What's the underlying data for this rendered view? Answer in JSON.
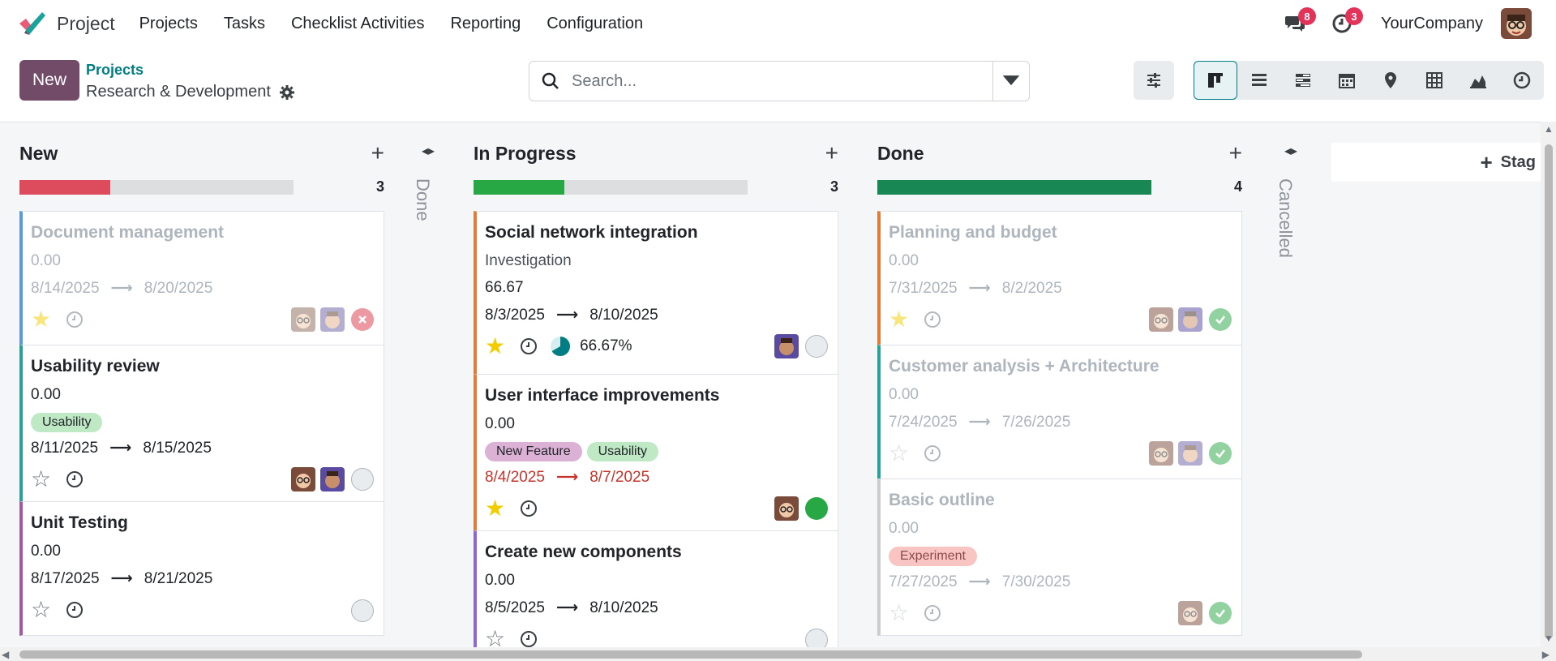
{
  "navbar": {
    "app_name": "Project",
    "menu": [
      "Projects",
      "Tasks",
      "Checklist Activities",
      "Reporting",
      "Configuration"
    ],
    "messages_count": "8",
    "activities_count": "3",
    "company": "YourCompany"
  },
  "control_panel": {
    "new_label": "New",
    "breadcrumb_parent": "Projects",
    "breadcrumb_current": "Research & Development",
    "search_placeholder": "Search..."
  },
  "columns": [
    {
      "title": "New",
      "count": "3",
      "progress_color": "#dc4c5c",
      "progress_fraction": 0.33
    },
    {
      "title": "In Progress",
      "count": "3",
      "progress_color": "#28a745",
      "progress_fraction": 0.33
    },
    {
      "title": "Done",
      "count": "4",
      "progress_color": "#198754",
      "progress_fraction": 1.0
    }
  ],
  "folded": [
    "Done",
    "Cancelled"
  ],
  "add_stage_label": "Stag",
  "cards": {
    "c1": {
      "title": "Document management",
      "hours": "0.00",
      "start": "8/14/2025",
      "end": "8/20/2025"
    },
    "c2": {
      "title": "Usability review",
      "hours": "0.00",
      "tag": "Usability",
      "start": "8/11/2025",
      "end": "8/15/2025"
    },
    "c3": {
      "title": "Unit Testing",
      "hours": "0.00",
      "start": "8/17/2025",
      "end": "8/21/2025"
    },
    "c4": {
      "title": "Social network integration",
      "subtitle": "Investigation",
      "hours": "66.67",
      "start": "8/3/2025",
      "end": "8/10/2025",
      "progress": "66.67%"
    },
    "c5": {
      "title": "User interface improvements",
      "hours": "0.00",
      "tags": [
        "New Feature",
        "Usability"
      ],
      "start": "8/4/2025",
      "end": "8/7/2025"
    },
    "c6": {
      "title": "Create new components",
      "hours": "0.00",
      "start": "8/5/2025",
      "end": "8/10/2025"
    },
    "c7": {
      "title": "Planning and budget",
      "hours": "0.00",
      "start": "7/31/2025",
      "end": "8/2/2025"
    },
    "c8": {
      "title": "Customer analysis + Architecture",
      "hours": "0.00",
      "start": "7/24/2025",
      "end": "7/26/2025"
    },
    "c9": {
      "title": "Basic outline",
      "hours": "0.00",
      "tag": "Experiment",
      "start": "7/27/2025",
      "end": "7/30/2025"
    }
  },
  "colors": {
    "brand": "#714b67",
    "accent": "#017e84",
    "tag_usability_bg": "#bfe8c4",
    "tag_newfeature_bg": "#dcb1d6",
    "tag_experiment_bg": "#f8c5c3"
  }
}
